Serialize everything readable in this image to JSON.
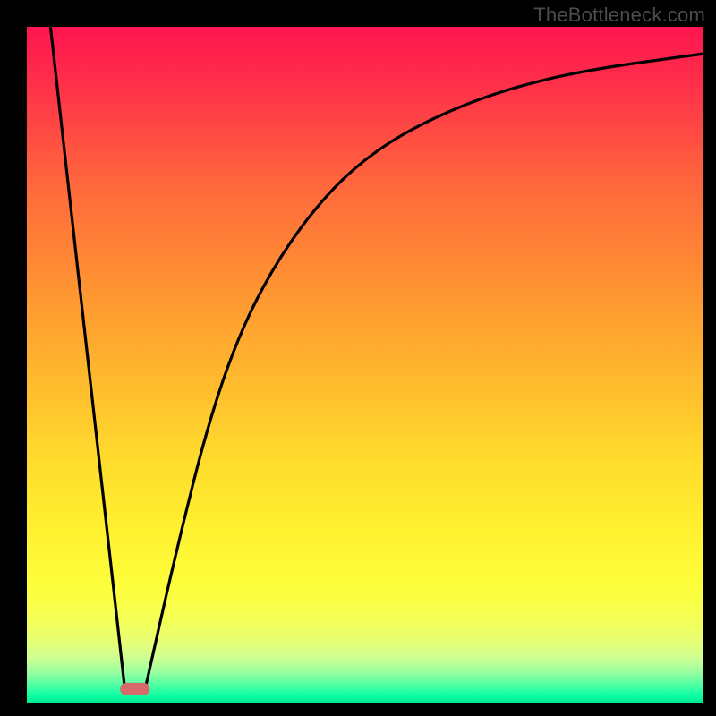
{
  "watermark": "TheBottleneck.com",
  "chart_data": {
    "type": "line",
    "title": "",
    "xlabel": "",
    "ylabel": "",
    "xlim": [
      0,
      100
    ],
    "ylim": [
      0,
      100
    ],
    "series": [
      {
        "name": "left-branch",
        "x": [
          3.5,
          14.5
        ],
        "values": [
          100,
          2
        ]
      },
      {
        "name": "right-branch",
        "x": [
          17.5,
          22,
          27,
          32,
          38,
          45,
          52,
          60,
          70,
          82,
          100
        ],
        "values": [
          2,
          22,
          42,
          56,
          67,
          76,
          82,
          86.5,
          90.5,
          93.5,
          96
        ]
      }
    ],
    "marker": {
      "name": "bottleneck-point",
      "x_center": 16,
      "x_halfwidth": 2.2,
      "y": 2,
      "color": "#d66a6a"
    },
    "background": {
      "type": "vertical-gradient",
      "stops": [
        {
          "pos": 0,
          "color": "#ff1550"
        },
        {
          "pos": 50,
          "color": "#ffbb2d"
        },
        {
          "pos": 80,
          "color": "#fff833"
        },
        {
          "pos": 100,
          "color": "#00e88f"
        }
      ]
    }
  }
}
